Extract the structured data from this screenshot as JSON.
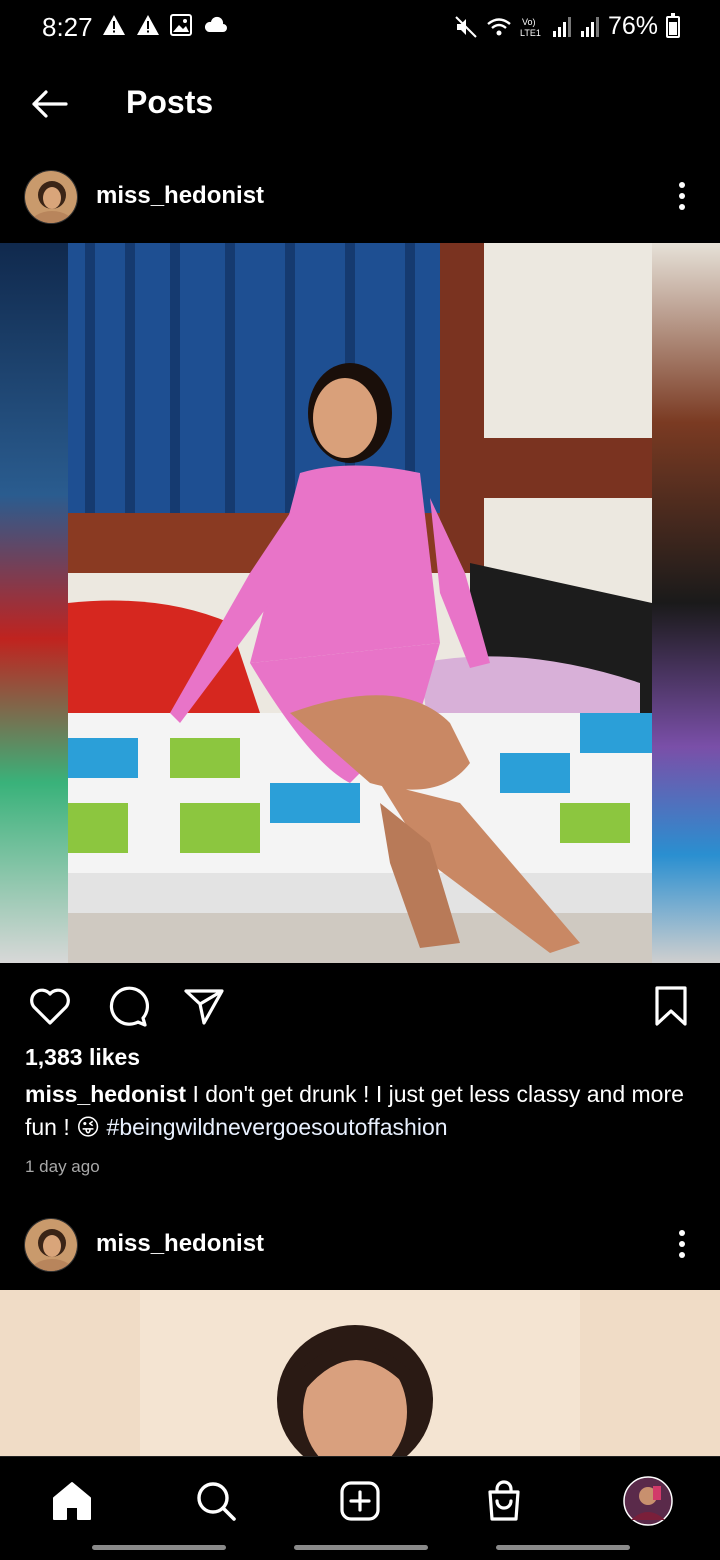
{
  "status_bar": {
    "time": "8:27",
    "battery": "76%"
  },
  "header": {
    "title": "Posts"
  },
  "posts": [
    {
      "username": "miss_hedonist",
      "likes": "1,383 likes",
      "caption_user": "miss_hedonist",
      "caption_text": "I don't get drunk ! I just get less classy and more fun ! ",
      "caption_emoji": "😜",
      "hashtag": "#beingwildnevergoesoutoffashion",
      "time": "1 day ago"
    },
    {
      "username": "miss_hedonist"
    }
  ],
  "colors": {
    "background": "#000000",
    "text": "#ffffff",
    "muted": "#a8a8a8"
  },
  "icons": {
    "back": "back-arrow-icon",
    "more": "more-vertical-icon",
    "like": "heart-icon",
    "comment": "comment-icon",
    "share": "send-icon",
    "save": "bookmark-icon",
    "home": "home-icon",
    "search": "search-icon",
    "create": "plus-square-icon",
    "shop": "shopping-bag-icon",
    "profile": "profile-avatar"
  }
}
